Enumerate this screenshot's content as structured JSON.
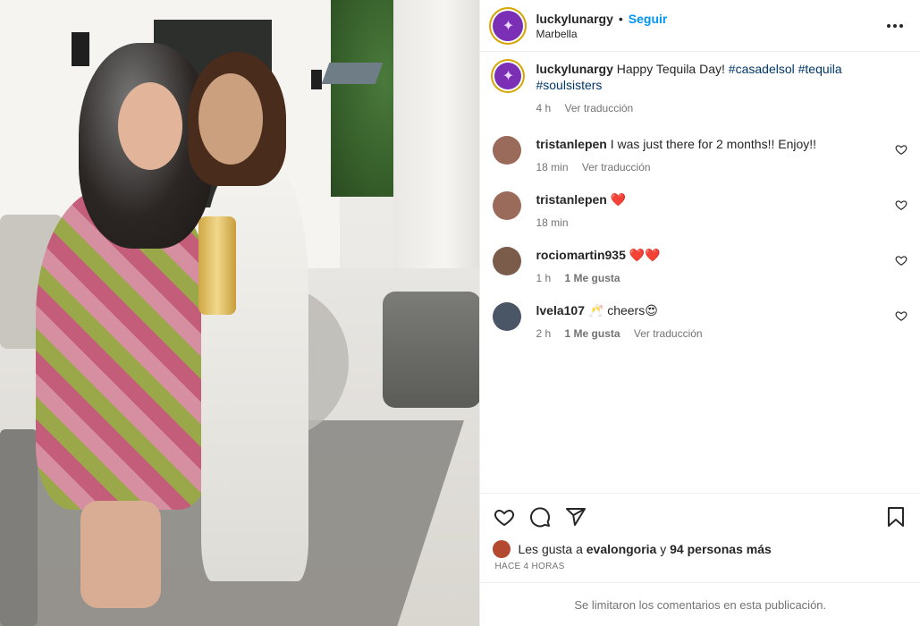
{
  "post": {
    "username": "luckylunargy",
    "location": "Marbella",
    "follow_label": "Seguir",
    "separator": "•"
  },
  "caption": {
    "username": "luckylunargy",
    "text": "Happy Tequila Day!",
    "hashtags": [
      "#casadelsol",
      "#tequila",
      "#soulsisters"
    ],
    "time": "4 h",
    "translate": "Ver traducción"
  },
  "comments": [
    {
      "username": "tristanlepen",
      "text": "I was just there for 2 months!! Enjoy!!",
      "time": "18 min",
      "likes": "",
      "translate": "Ver traducción",
      "avatar_color": "#9a6a5a"
    },
    {
      "username": "tristanlepen",
      "text": "❤️",
      "time": "18 min",
      "likes": "",
      "translate": "",
      "avatar_color": "#9a6a5a"
    },
    {
      "username": "rociomartin935",
      "text": "❤️❤️",
      "time": "1 h",
      "likes": "1 Me gusta",
      "translate": "",
      "avatar_color": "#7b5c4a"
    },
    {
      "username": "lvela107",
      "text": "🥂 cheers😍",
      "time": "2 h",
      "likes": "1 Me gusta",
      "translate": "Ver traducción",
      "avatar_color": "#4a5565"
    }
  ],
  "likes": {
    "prefix": "Les gusta a",
    "first": "evalongoria",
    "joiner": "y",
    "rest": "94 personas más"
  },
  "timestamp": "HACE 4 HORAS",
  "limited_comments": "Se limitaron los comentarios en esta publicación.",
  "icons": {
    "like": "heart-icon",
    "comment": "comment-icon",
    "share": "share-icon",
    "save": "bookmark-icon",
    "more": "more-icon"
  },
  "colors": {
    "link": "#0095f6",
    "hashtag": "#00376b",
    "heart": "#ed4956",
    "muted": "#737373"
  }
}
